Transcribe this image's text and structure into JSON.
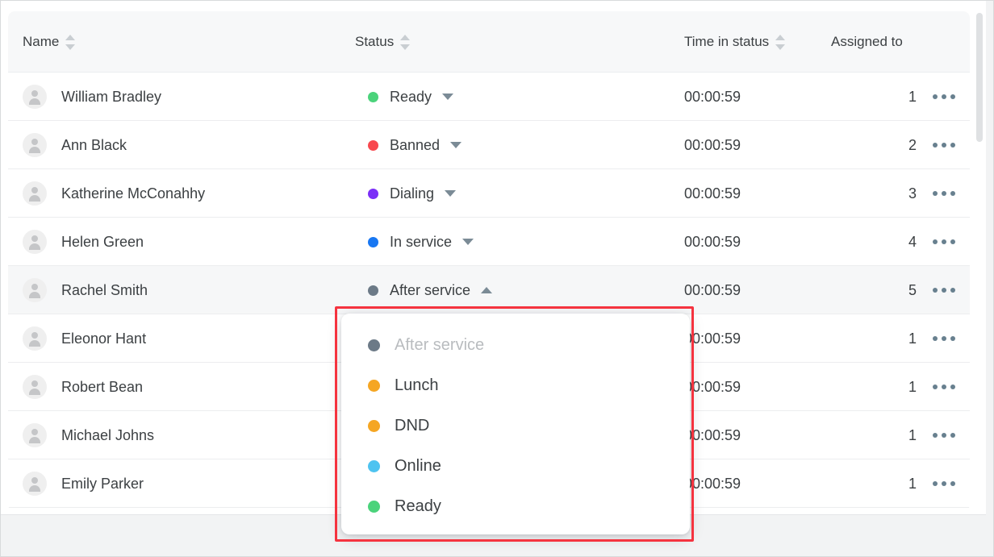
{
  "table": {
    "columns": [
      {
        "key": "name",
        "label": "Name",
        "sortable": true
      },
      {
        "key": "status",
        "label": "Status",
        "sortable": true
      },
      {
        "key": "time",
        "label": "Time in status",
        "sortable": true
      },
      {
        "key": "assigned",
        "label": "Assigned to",
        "sortable": false
      }
    ],
    "rows": [
      {
        "name": "William Bradley",
        "status": "Ready",
        "status_color": "#4bd37b",
        "caret": "down",
        "time": "00:00:59",
        "assigned": "1",
        "selected": false
      },
      {
        "name": "Ann Black",
        "status": "Banned",
        "status_color": "#f8484e",
        "caret": "down",
        "time": "00:00:59",
        "assigned": "2",
        "selected": false
      },
      {
        "name": "Katherine McConahhy",
        "status": "Dialing",
        "status_color": "#7b2ff7",
        "caret": "down",
        "time": "00:00:59",
        "assigned": "3",
        "selected": false
      },
      {
        "name": "Helen Green",
        "status": "In service",
        "status_color": "#1877f2",
        "caret": "down",
        "time": "00:00:59",
        "assigned": "4",
        "selected": false
      },
      {
        "name": "Rachel Smith",
        "status": "After service",
        "status_color": "#6c7a87",
        "caret": "up",
        "time": "00:00:59",
        "assigned": "5",
        "selected": true
      },
      {
        "name": "Eleonor Hant",
        "status": "",
        "status_color": "",
        "caret": "",
        "time": "00:00:59",
        "assigned": "1",
        "selected": false
      },
      {
        "name": "Robert Bean",
        "status": "",
        "status_color": "",
        "caret": "",
        "time": "00:00:59",
        "assigned": "1",
        "selected": false
      },
      {
        "name": "Michael Johns",
        "status": "",
        "status_color": "",
        "caret": "",
        "time": "00:00:59",
        "assigned": "1",
        "selected": false
      },
      {
        "name": "Emily Parker",
        "status": "",
        "status_color": "",
        "caret": "",
        "time": "00:00:59",
        "assigned": "1",
        "selected": false
      }
    ],
    "row_menu_icon": "overflow-ellipsis-icon"
  },
  "status_dropdown": {
    "open": true,
    "current": "After service",
    "options": [
      {
        "label": "After service",
        "color": "#6c7a87",
        "current": true
      },
      {
        "label": "Lunch",
        "color": "#f5a623",
        "current": false
      },
      {
        "label": "DND",
        "color": "#f5a623",
        "current": false
      },
      {
        "label": "Online",
        "color": "#4ec3f0",
        "current": false
      },
      {
        "label": "Ready",
        "color": "#4bd37b",
        "current": false
      }
    ]
  },
  "annotation": {
    "type": "highlight-rectangle",
    "color": "#f5333f"
  },
  "scrollbar": {
    "vertical": {
      "visible": true
    },
    "horizontal": {
      "visible": false
    }
  }
}
